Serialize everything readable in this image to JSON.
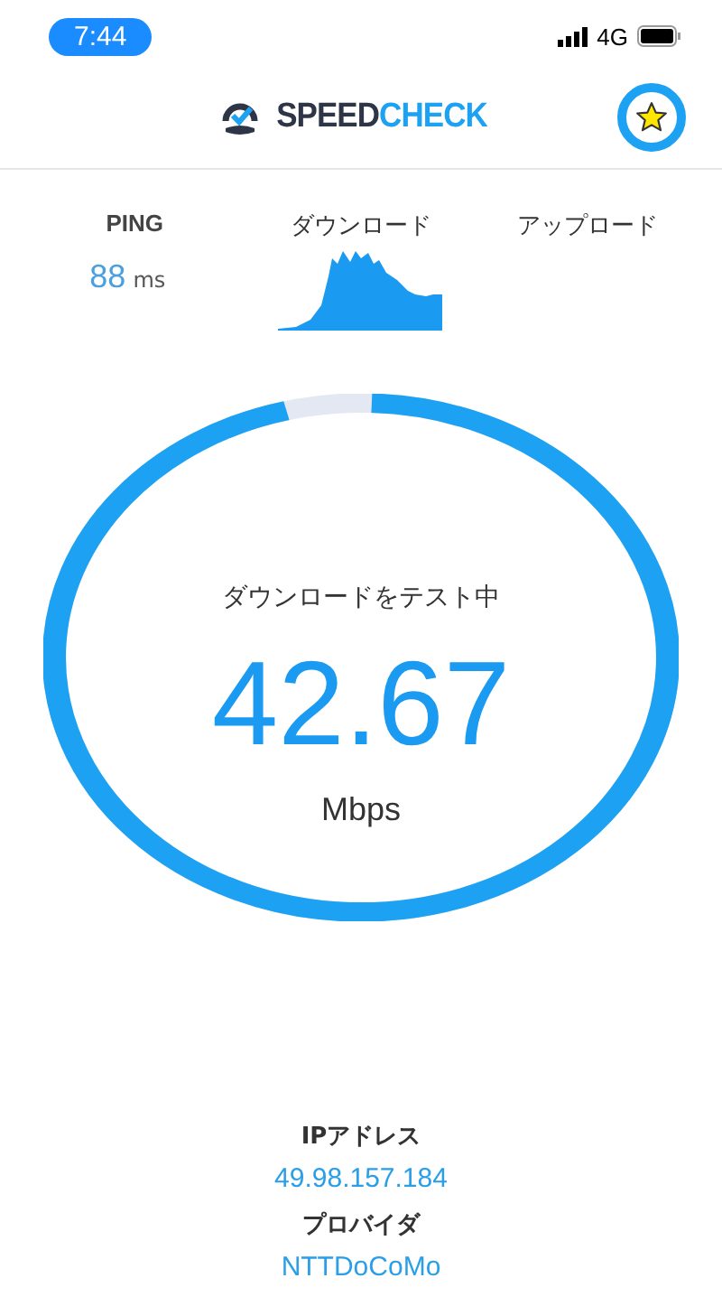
{
  "status_bar": {
    "time": "7:44",
    "network": "4G"
  },
  "header": {
    "logo": {
      "part_1": "SPEED",
      "part_2": "CHECK"
    }
  },
  "stats": [
    {
      "kind": "value",
      "label": "PING",
      "value": "88",
      "unit": "ms"
    },
    {
      "kind": "graph",
      "label": "ダウンロード"
    },
    {
      "kind": "empty",
      "label": "アップロード"
    }
  ],
  "gauge": {
    "status": "ダウンロードをテスト中",
    "value": "42.67",
    "unit": "Mbps"
  },
  "info": [
    {
      "label": "IPアドレス",
      "value": "49.98.157.184"
    },
    {
      "label": "プロバイダ",
      "value": "NTTDoCoMo"
    }
  ]
}
